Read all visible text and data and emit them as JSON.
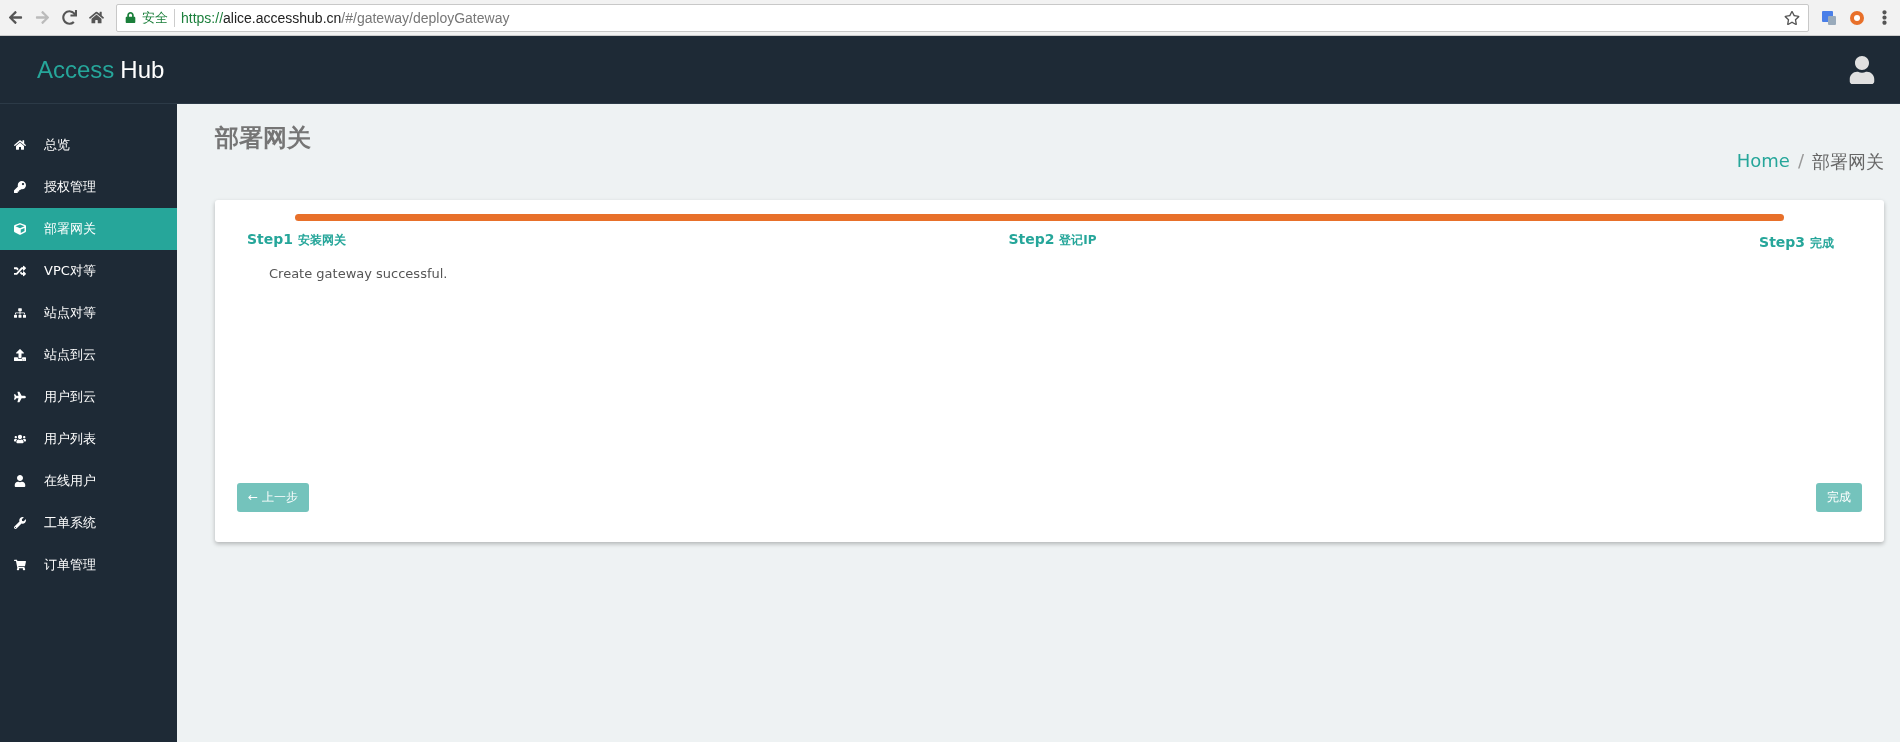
{
  "browser": {
    "security": "安全",
    "url_scheme": "https://",
    "url_host": "alice.accesshub.cn",
    "url_path": "/#/gateway/deployGateway"
  },
  "header": {
    "logo_accent": "Access",
    "logo_rest": "Hub"
  },
  "sidebar": {
    "items": [
      {
        "label": "总览",
        "selected": false
      },
      {
        "label": "授权管理",
        "selected": false
      },
      {
        "label": "部署网关",
        "selected": true
      },
      {
        "label": "VPC对等",
        "selected": false
      },
      {
        "label": "站点对等",
        "selected": false
      },
      {
        "label": "站点到云",
        "selected": false
      },
      {
        "label": "用户到云",
        "selected": false
      },
      {
        "label": "用户列表",
        "selected": false
      },
      {
        "label": "在线用户",
        "selected": false
      },
      {
        "label": "工单系统",
        "selected": false
      },
      {
        "label": "订单管理",
        "selected": false
      }
    ]
  },
  "page": {
    "title": "部署网关",
    "breadcrumb": [
      "Home",
      "部署网关"
    ],
    "breadcrumb_separator": "/"
  },
  "wizard": {
    "progress": {
      "level": 1
    },
    "steps": [
      {
        "label": "Step1",
        "name": "安装网关"
      },
      {
        "label": "Step2",
        "name": "登记IP"
      },
      {
        "label": "Step3",
        "name": "完成"
      }
    ],
    "message": "Create gateway successful.",
    "back_arrow": "←",
    "back_button": "上一步",
    "finish_button": "完成"
  }
}
